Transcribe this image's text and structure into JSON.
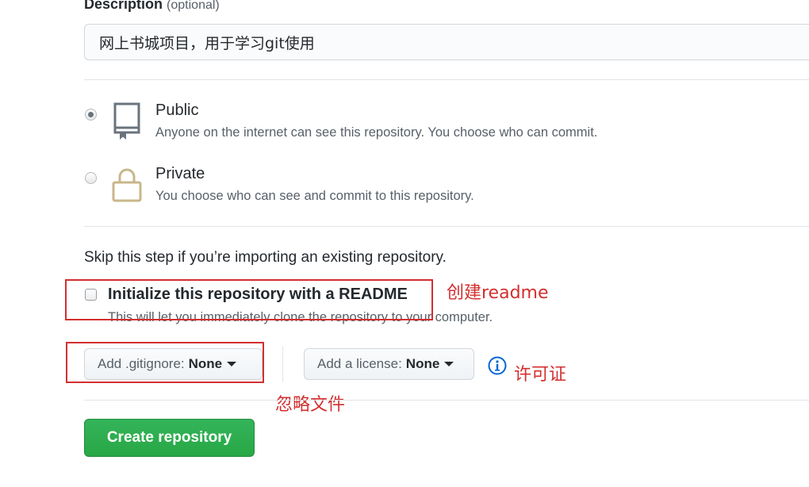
{
  "description": {
    "label": "Description",
    "optional_note": "(optional)",
    "value": "网上书城项目，用于学习git使用"
  },
  "visibility": {
    "public": {
      "title": "Public",
      "note": "Anyone on the internet can see this repository. You choose who can commit.",
      "icon": "repo-book-icon",
      "selected": true
    },
    "private": {
      "title": "Private",
      "note": "You choose who can see and commit to this repository.",
      "icon": "lock-icon",
      "selected": false
    }
  },
  "init": {
    "skip_text": "Skip this step if you’re importing an existing repository.",
    "readme_label": "Initialize this repository with a README",
    "readme_note": "This will let you immediately clone the repository to your computer.",
    "readme_checked": false
  },
  "gitignore": {
    "label": "Add .gitignore:",
    "value": "None"
  },
  "license": {
    "label": "Add a license:",
    "value": "None"
  },
  "annotations": {
    "readme": "创建readme",
    "license": "许可证",
    "gitignore": "忽略文件"
  },
  "create_button": "Create repository",
  "colors": {
    "annotation_red": "#d32f2f",
    "create_green": "#2ea44f",
    "info_blue": "#0366d6",
    "icon_gray": "#6a737d",
    "lock_tan": "#b08800"
  }
}
